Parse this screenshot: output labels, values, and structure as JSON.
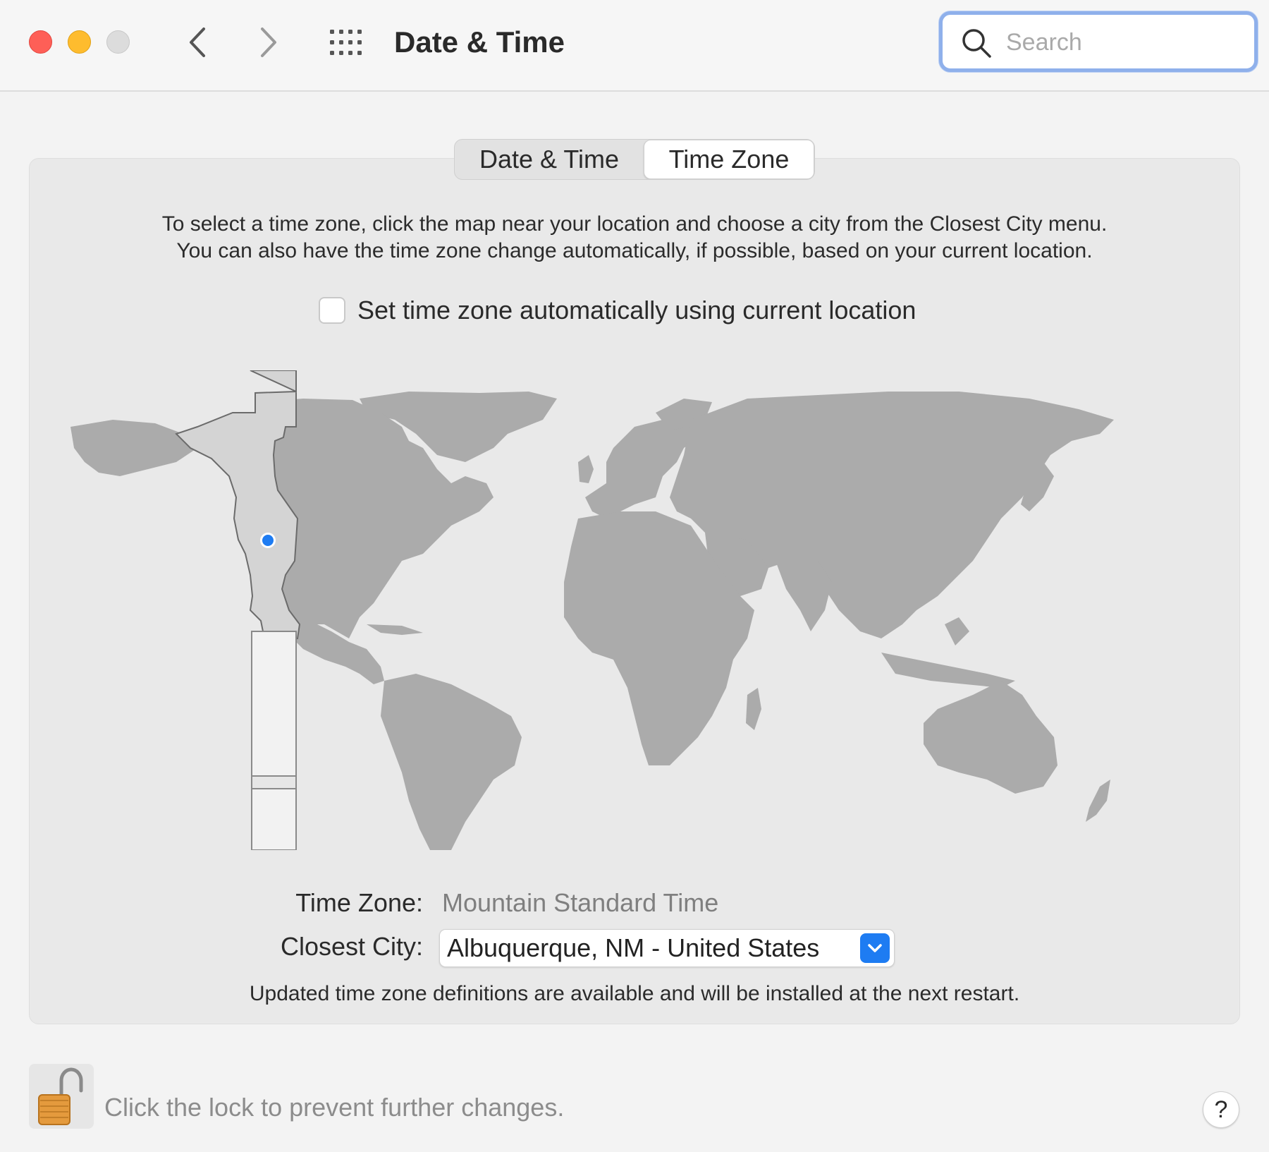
{
  "window": {
    "title": "Date & Time",
    "traffic_lights": {
      "close": "#fe5f57",
      "minimize": "#febc2e",
      "zoom": "#dcdcdc"
    }
  },
  "toolbar": {
    "back_icon": "chevron-left-icon",
    "forward_icon": "chevron-right-icon",
    "show_all_icon": "grid-icon",
    "search": {
      "placeholder": "Search",
      "value": ""
    }
  },
  "tabs": [
    {
      "label": "Date & Time",
      "selected": false
    },
    {
      "label": "Time Zone",
      "selected": true
    }
  ],
  "time_zone_pane": {
    "instructions_line1": "To select a time zone, click the map near your location and choose a city from the Closest City menu.",
    "instructions_line2": "You can also have the time zone change automatically, if possible, based on your current location.",
    "auto_checkbox": {
      "label": "Set time zone automatically using current location",
      "checked": false
    },
    "time_zone_label": "Time Zone:",
    "time_zone_value": "Mountain Standard Time",
    "closest_city_label": "Closest City:",
    "closest_city_value": "Albuquerque, NM - United States",
    "notice": "Updated time zone definitions are available and will be installed at the next restart.",
    "accent_color": "#1e7cf2"
  },
  "footer": {
    "lock_text": "Click the lock to prevent further changes.",
    "lock_icon": "unlocked-padlock-icon",
    "help_label": "?"
  }
}
